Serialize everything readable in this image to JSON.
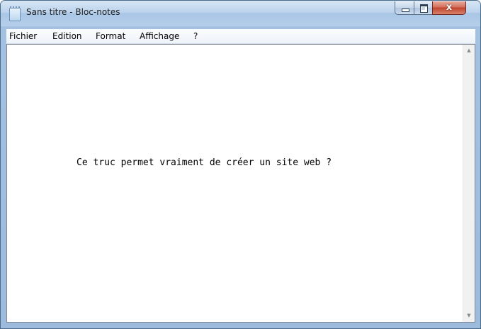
{
  "window": {
    "title": "Sans titre - Bloc-notes",
    "app_icon": "notepad-icon",
    "controls": {
      "minimize_icon": "minimize-icon",
      "maximize_icon": "maximize-icon",
      "close_glyph": "x"
    }
  },
  "menubar": {
    "items": [
      {
        "label": "Fichier"
      },
      {
        "label": "Edition"
      },
      {
        "label": "Format"
      },
      {
        "label": "Affichage"
      },
      {
        "label": "?"
      }
    ]
  },
  "editor": {
    "text": "Ce truc permet vraiment de créer un site web ?"
  },
  "scrollbar": {
    "up_glyph": "▲",
    "down_glyph": "▼"
  },
  "colors": {
    "titlebar": "#b9d1ea",
    "close_button": "#c0462f",
    "editor_bg": "#ffffff"
  }
}
